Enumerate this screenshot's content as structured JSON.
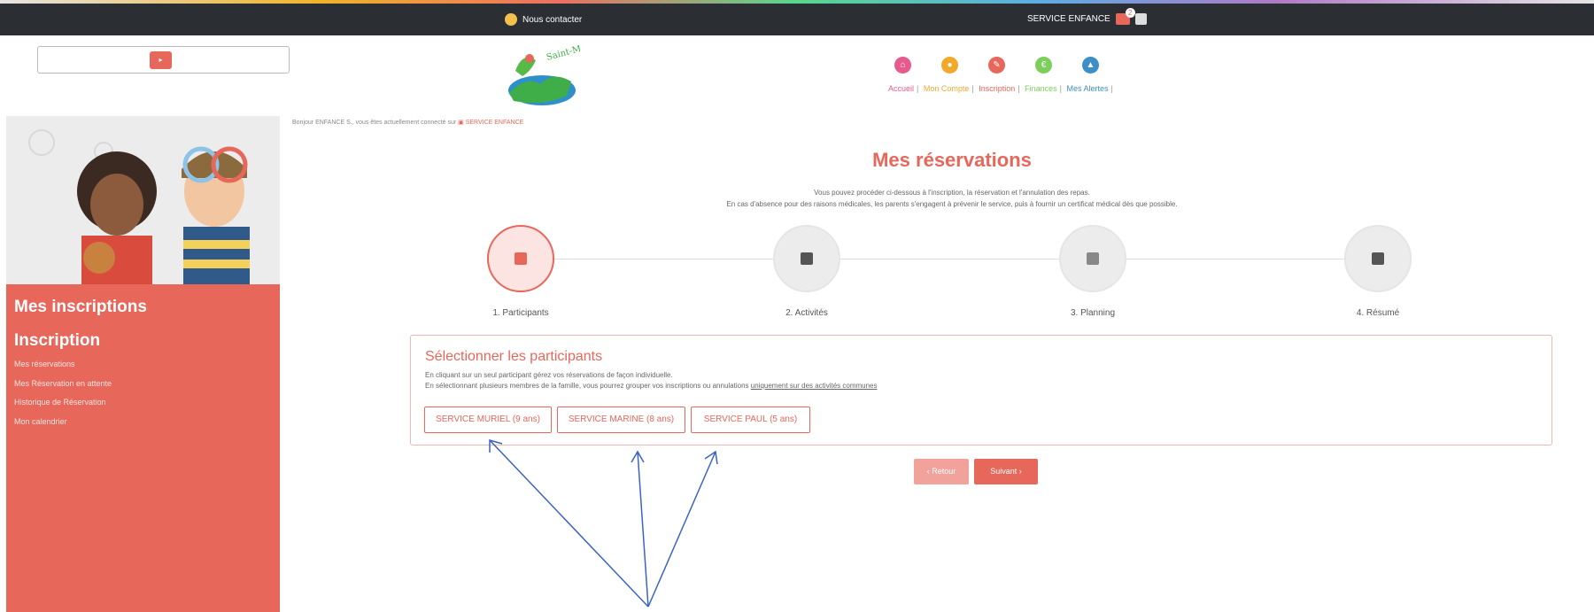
{
  "topbar": {
    "contact_label": "Nous contacter",
    "service_label": "SERVICE ENFANCE",
    "notification_count": "2"
  },
  "logo": {
    "text": "Saint-Marie"
  },
  "nav": {
    "items": [
      {
        "label": "Accueil",
        "icon": "home-icon",
        "color": "#e75a8d"
      },
      {
        "label": "Mon Compte",
        "icon": "user-icon",
        "color": "#f0a92b"
      },
      {
        "label": "Inscription",
        "icon": "pencil-icon",
        "color": "#e7675b"
      },
      {
        "label": "Finances",
        "icon": "euro-icon",
        "color": "#7ccf5a"
      },
      {
        "label": "Mes Alertes",
        "icon": "alert-icon",
        "color": "#3b8fc4"
      }
    ]
  },
  "sidebar": {
    "title": "Mes inscriptions",
    "subtitle": "Inscription",
    "links": [
      "Mes réservations",
      "Mes Réservation en attente",
      "Historique de Réservation",
      "Mon calendrier"
    ]
  },
  "greeting": {
    "prefix": "Bonjour ENFANCE S., vous êtes actuellement connecté sur",
    "service": "SERVICE ENFANCE"
  },
  "main": {
    "title": "Mes réservations",
    "intro_line1": "Vous pouvez procéder ci-dessous à l'inscription, la réservation et l'annulation des repas.",
    "intro_line2": "En cas d'absence pour des raisons médicales, les parents s'engagent à prévenir le service, puis à fournir un certificat médical dès que possible."
  },
  "steps": [
    {
      "label": "1. Participants",
      "icon": "users-icon",
      "active": true
    },
    {
      "label": "2. Activités",
      "icon": "book-icon",
      "active": false
    },
    {
      "label": "3. Planning",
      "icon": "calendar-icon",
      "active": false
    },
    {
      "label": "4. Résumé",
      "icon": "check-icon",
      "active": false
    }
  ],
  "selector": {
    "title": "Sélectionner les participants",
    "line1": "En cliquant sur un seul participant gérez vos réservations de façon individuelle.",
    "line2_prefix": "En sélectionnant plusieurs membres de la famille, vous pourrez grouper vos inscriptions ou annulations",
    "line2_emphasis": "uniquement sur des activités communes",
    "participants": [
      "SERVICE MURIEL (9 ans)",
      "SERVICE MARINE (8 ans)",
      "SERVICE PAUL (5 ans)"
    ]
  },
  "buttons": {
    "back_label": "‹ Retour",
    "next_label": "Suivant ›"
  },
  "colors": {
    "accent": "#e7675b",
    "topbar": "#2b2f33",
    "annotation_arrow": "#3b63c4"
  }
}
